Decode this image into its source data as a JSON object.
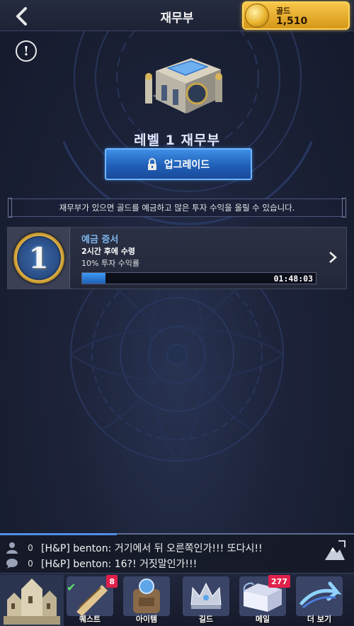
{
  "header": {
    "title": "재무부",
    "gold_label": "골드",
    "gold_value": "1,510"
  },
  "building": {
    "level_title": "레벨 1 재무부",
    "upgrade_label": "업그레이드"
  },
  "notice": "재무부가 있으면 골드를 예금하고 많은 투자 수익을 올릴 수 있습니다.",
  "deposit": {
    "medal_number": "1",
    "title": "예금 증서",
    "time": "2시간 후에 수령",
    "yield": "10% 투자 수익률",
    "progress": 0.1,
    "remaining": "01:48:03"
  },
  "chat": {
    "rows": [
      {
        "count": "0",
        "message": "[H&P] benton: 거기에서 뒤 오른쪽인가!!! 또다시!!"
      },
      {
        "count": "0",
        "message": "[H&P] benton: 16?! 거짓말인가!!!"
      }
    ]
  },
  "nav": {
    "quest": {
      "label": "퀘스트",
      "badge": "8"
    },
    "item": {
      "label": "아이템"
    },
    "guild": {
      "label": "길드"
    },
    "mail": {
      "label": "메일",
      "badge": "277"
    },
    "more": {
      "label": "더 보기"
    }
  },
  "colors": {
    "accent_blue": "#3f8fe6",
    "gold": "#f8c64a",
    "badge_red": "#e0204a",
    "deposit_title": "#7fb6ee"
  }
}
